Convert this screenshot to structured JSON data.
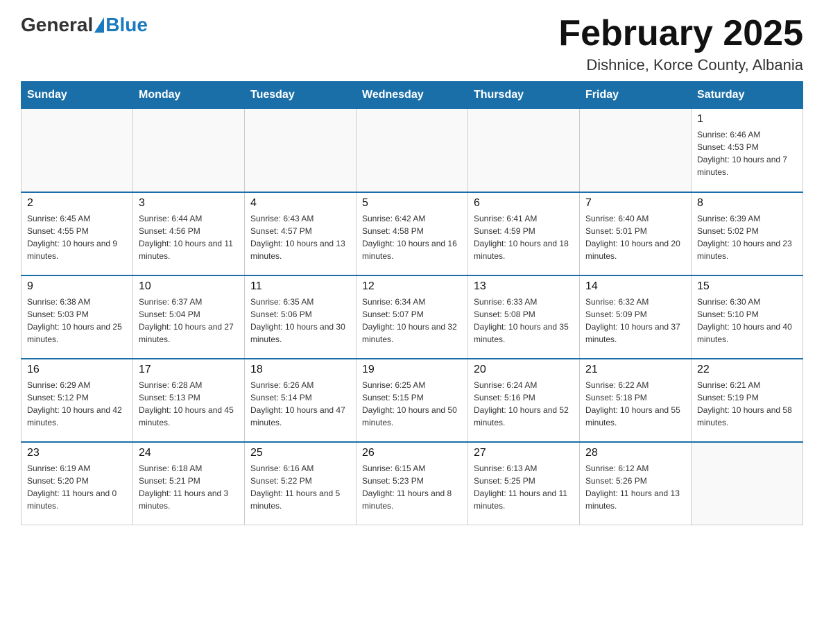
{
  "header": {
    "logo_general": "General",
    "logo_blue": "Blue",
    "month_title": "February 2025",
    "location": "Dishnice, Korce County, Albania"
  },
  "days_of_week": [
    "Sunday",
    "Monday",
    "Tuesday",
    "Wednesday",
    "Thursday",
    "Friday",
    "Saturday"
  ],
  "weeks": [
    {
      "days": [
        {
          "number": "",
          "info": ""
        },
        {
          "number": "",
          "info": ""
        },
        {
          "number": "",
          "info": ""
        },
        {
          "number": "",
          "info": ""
        },
        {
          "number": "",
          "info": ""
        },
        {
          "number": "",
          "info": ""
        },
        {
          "number": "1",
          "info": "Sunrise: 6:46 AM\nSunset: 4:53 PM\nDaylight: 10 hours and 7 minutes."
        }
      ]
    },
    {
      "days": [
        {
          "number": "2",
          "info": "Sunrise: 6:45 AM\nSunset: 4:55 PM\nDaylight: 10 hours and 9 minutes."
        },
        {
          "number": "3",
          "info": "Sunrise: 6:44 AM\nSunset: 4:56 PM\nDaylight: 10 hours and 11 minutes."
        },
        {
          "number": "4",
          "info": "Sunrise: 6:43 AM\nSunset: 4:57 PM\nDaylight: 10 hours and 13 minutes."
        },
        {
          "number": "5",
          "info": "Sunrise: 6:42 AM\nSunset: 4:58 PM\nDaylight: 10 hours and 16 minutes."
        },
        {
          "number": "6",
          "info": "Sunrise: 6:41 AM\nSunset: 4:59 PM\nDaylight: 10 hours and 18 minutes."
        },
        {
          "number": "7",
          "info": "Sunrise: 6:40 AM\nSunset: 5:01 PM\nDaylight: 10 hours and 20 minutes."
        },
        {
          "number": "8",
          "info": "Sunrise: 6:39 AM\nSunset: 5:02 PM\nDaylight: 10 hours and 23 minutes."
        }
      ]
    },
    {
      "days": [
        {
          "number": "9",
          "info": "Sunrise: 6:38 AM\nSunset: 5:03 PM\nDaylight: 10 hours and 25 minutes."
        },
        {
          "number": "10",
          "info": "Sunrise: 6:37 AM\nSunset: 5:04 PM\nDaylight: 10 hours and 27 minutes."
        },
        {
          "number": "11",
          "info": "Sunrise: 6:35 AM\nSunset: 5:06 PM\nDaylight: 10 hours and 30 minutes."
        },
        {
          "number": "12",
          "info": "Sunrise: 6:34 AM\nSunset: 5:07 PM\nDaylight: 10 hours and 32 minutes."
        },
        {
          "number": "13",
          "info": "Sunrise: 6:33 AM\nSunset: 5:08 PM\nDaylight: 10 hours and 35 minutes."
        },
        {
          "number": "14",
          "info": "Sunrise: 6:32 AM\nSunset: 5:09 PM\nDaylight: 10 hours and 37 minutes."
        },
        {
          "number": "15",
          "info": "Sunrise: 6:30 AM\nSunset: 5:10 PM\nDaylight: 10 hours and 40 minutes."
        }
      ]
    },
    {
      "days": [
        {
          "number": "16",
          "info": "Sunrise: 6:29 AM\nSunset: 5:12 PM\nDaylight: 10 hours and 42 minutes."
        },
        {
          "number": "17",
          "info": "Sunrise: 6:28 AM\nSunset: 5:13 PM\nDaylight: 10 hours and 45 minutes."
        },
        {
          "number": "18",
          "info": "Sunrise: 6:26 AM\nSunset: 5:14 PM\nDaylight: 10 hours and 47 minutes."
        },
        {
          "number": "19",
          "info": "Sunrise: 6:25 AM\nSunset: 5:15 PM\nDaylight: 10 hours and 50 minutes."
        },
        {
          "number": "20",
          "info": "Sunrise: 6:24 AM\nSunset: 5:16 PM\nDaylight: 10 hours and 52 minutes."
        },
        {
          "number": "21",
          "info": "Sunrise: 6:22 AM\nSunset: 5:18 PM\nDaylight: 10 hours and 55 minutes."
        },
        {
          "number": "22",
          "info": "Sunrise: 6:21 AM\nSunset: 5:19 PM\nDaylight: 10 hours and 58 minutes."
        }
      ]
    },
    {
      "days": [
        {
          "number": "23",
          "info": "Sunrise: 6:19 AM\nSunset: 5:20 PM\nDaylight: 11 hours and 0 minutes."
        },
        {
          "number": "24",
          "info": "Sunrise: 6:18 AM\nSunset: 5:21 PM\nDaylight: 11 hours and 3 minutes."
        },
        {
          "number": "25",
          "info": "Sunrise: 6:16 AM\nSunset: 5:22 PM\nDaylight: 11 hours and 5 minutes."
        },
        {
          "number": "26",
          "info": "Sunrise: 6:15 AM\nSunset: 5:23 PM\nDaylight: 11 hours and 8 minutes."
        },
        {
          "number": "27",
          "info": "Sunrise: 6:13 AM\nSunset: 5:25 PM\nDaylight: 11 hours and 11 minutes."
        },
        {
          "number": "28",
          "info": "Sunrise: 6:12 AM\nSunset: 5:26 PM\nDaylight: 11 hours and 13 minutes."
        },
        {
          "number": "",
          "info": ""
        }
      ]
    }
  ]
}
